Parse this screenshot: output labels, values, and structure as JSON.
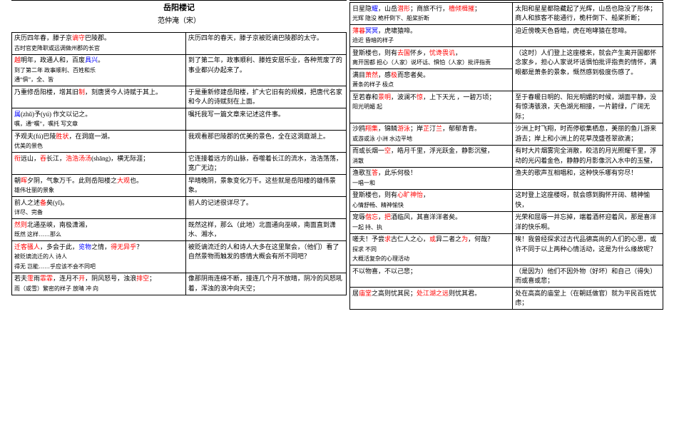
{
  "title": "岳阳楼记",
  "author": "范仲淹（宋）",
  "left_rows": [
    {
      "orig_lines": [
        {
          "segs": [
            {
              "t": "庆历四年春，滕子京"
            },
            {
              "t": "谪守",
              "r": true
            },
            {
              "t": "巴陵郡。"
            }
          ]
        },
        {
          "segs": [
            {
              "t": "古时官吏降职或远调做州郡的长官",
              "sub": true
            }
          ]
        }
      ],
      "tr": "庆历四年的春天，滕子京被贬谪巴陵郡的太守。",
      "rowspan": 1
    },
    {
      "orig_lines": [
        {
          "segs": [
            {
              "t": "越",
              "r": true
            },
            {
              "t": "明年"
            },
            {
              "t": "，政通人和，"
            },
            {
              "t": "百废"
            },
            {
              "t": "具兴",
              "bl": true
            },
            {
              "t": "。"
            }
          ]
        },
        {
          "segs": [
            {
              "t": "到了第二年  政事顺利、百姓和乐",
              "sub": true
            }
          ]
        },
        {
          "segs": [
            {
              "t": "通“俱”，全、皆",
              "sub": true
            }
          ]
        }
      ],
      "tr": "到了第二年，政事顺利、滕姓安居乐业，各种荒废了的事业都兴办起来了。"
    },
    {
      "orig_lines": [
        {
          "segs": [
            {
              "t": "乃重修岳阳楼，增其旧"
            },
            {
              "t": "制",
              "r": true
            },
            {
              "t": "，刻唐贤今人诗赋于其上。"
            }
          ]
        }
      ],
      "tr": "于是重新修建岳阳楼，扩大它旧有的规模，把唐代名家和今人的诗赋刻在上面。"
    },
    {
      "orig_lines": [
        {
          "segs": [
            {
              "t": "属",
              "bl": true
            },
            {
              "t": "(zhǔ)予(yú) 作文以记之。"
            }
          ]
        },
        {
          "segs": [
            {
              "t": "嘱，通“嘱”，嘱托    写文章",
              "sub": true
            }
          ]
        }
      ],
      "tr": "嘱托我写一篇文章来记述这件事。"
    },
    {
      "orig_lines": [
        {
          "segs": [
            {
              "t": "予观夫(fú)巴陵"
            },
            {
              "t": "胜状",
              "r": true
            },
            {
              "t": "，在洞庭一湖。"
            }
          ]
        },
        {
          "segs": [
            {
              "t": "优美的景色",
              "sub": true
            }
          ]
        }
      ],
      "tr": "我观看那巴陵郡的优美的景色，全在这洞庭湖上。"
    },
    {
      "orig_lines": [
        {
          "segs": [
            {
              "t": "衔",
              "r": true
            },
            {
              "t": "远山，"
            },
            {
              "t": "吞",
              "r": true
            },
            {
              "t": "长江，"
            },
            {
              "t": "浩浩汤汤",
              "r": true
            },
            {
              "t": "(shāng)，横无际涯；"
            }
          ]
        }
      ],
      "tr": "它连接着远方的山脉，吞噬着长江的流水，浩浩荡荡，宽广无边；"
    },
    {
      "orig_lines": [
        {
          "segs": [
            {
              "t": "朝"
            },
            {
              "t": "晖",
              "r": true
            },
            {
              "t": "夕阴，气象万千。此则岳阳楼之"
            },
            {
              "t": "大观",
              "r": true
            },
            {
              "t": "也。"
            }
          ]
        },
        {
          "segs": [
            {
              "t": "雄伟壮丽的景象",
              "sub": true
            }
          ]
        }
      ],
      "tr": "早晴晚阴，景象变化万千。这些就是岳阳楼的雄伟景象。"
    },
    {
      "orig_lines": [
        {
          "segs": [
            {
              "t": "前人之述"
            },
            {
              "t": "备",
              "r": true
            },
            {
              "t": "矣(yǐ)。"
            }
          ]
        },
        {
          "segs": [
            {
              "t": "详尽、完备",
              "sub": true
            }
          ]
        }
      ],
      "tr": "前人的记述很详尽了。"
    },
    {
      "orig_lines": [
        {
          "segs": [
            {
              "t": "然则",
              "r": true
            },
            {
              "t": "北通巫峡，南极潇湘，"
            }
          ]
        },
        {
          "segs": [
            {
              "t": "既然    这样……那么",
              "sub": true
            }
          ]
        }
      ],
      "tr": "既然这样，那么（此地）北面通向巫峡，南面直到潇水、湘水，"
    },
    {
      "orig_lines": [
        {
          "segs": [
            {
              "t": "迁客",
              "r": true
            },
            {
              "t": "骚人",
              "r": true
            },
            {
              "t": "，多会于此，"
            },
            {
              "t": "览物",
              "bl": true
            },
            {
              "t": "之情，"
            },
            {
              "t": "得无异乎",
              "r": true
            },
            {
              "t": "？"
            }
          ]
        },
        {
          "segs": [
            {
              "t": "被贬谪流迁的人  诗人",
              "sub": true
            }
          ]
        },
        {
          "segs": [
            {
              "t": "得无    岂能……乎应该不会不同吧",
              "sub": true
            }
          ]
        }
      ],
      "tr": "被贬谪流迁的人和诗人大多在这里聚会，（他们）看了自然景物而触发的感情大概会有所不同吧？"
    },
    {
      "orig_lines": [
        {
          "segs": [
            {
              "t": "若夫"
            },
            {
              "t": "霪",
              "r": true
            },
            {
              "t": "雨"
            },
            {
              "t": "霏霏",
              "r": true
            },
            {
              "t": "，连月不"
            },
            {
              "t": "开",
              "r": true
            },
            {
              "t": "，阴风怒号，浊浪"
            },
            {
              "t": "排空",
              "r": true
            },
            {
              "t": "；"
            }
          ]
        },
        {
          "segs": [
            {
              "t": "雨（或雪）繁密的样子    放晴        冲 向",
              "sub": true
            }
          ]
        }
      ],
      "tr": "像那阴雨连绵不断，接连几个月不放晴，阴冷的风怒吼着，浑浊的浪冲向天空；"
    }
  ],
  "right_rows": [
    {
      "orig_lines": [
        {
          "segs": [
            {
              "t": "日星隐"
            },
            {
              "t": "耀",
              "bl": true
            },
            {
              "t": "，山岳"
            },
            {
              "t": "潜形",
              "r": true
            },
            {
              "t": "；商旅不行，"
            },
            {
              "t": "樯倾楫摧",
              "r": true
            },
            {
              "t": "；"
            }
          ]
        },
        {
          "segs": [
            {
              "t": "光辉      隐没              桅杆倒下、船桨折断",
              "sub": true
            }
          ]
        }
      ],
      "tr": "太阳和星星都隐藏起了光辉，山岳也隐没了形体；商人和旅客不能通行，桅杆倒下、船桨折断；"
    },
    {
      "orig_lines": [
        {
          "segs": [
            {
              "t": "薄暮",
              "r": true
            },
            {
              "t": "冥冥",
              "bl": true
            },
            {
              "t": "，虎啸猿啼。"
            }
          ]
        },
        {
          "segs": [
            {
              "t": "迫近  昏暗的样子",
              "sub": true
            }
          ]
        }
      ],
      "tr": "迫近傍晚天色昏暗，虎在咆哮猿在悲啼。"
    },
    {
      "orig_lines": [
        {
          "segs": [
            {
              "t": "登斯楼也，则有"
            },
            {
              "t": "去国",
              "r": true
            },
            {
              "t": "怀乡，"
            },
            {
              "t": "忧谗畏讥",
              "r": true
            },
            {
              "t": "，"
            }
          ]
        },
        {
          "segs": [
            {
              "t": "离开国都        担心（人家）说坏话、惧怕（人家）批评指责",
              "sub": true
            }
          ]
        }
      ],
      "tr": "（这时）人们登上这座楼来，就会产生离开国都怀念家乡，担心人家说坏话惧怕批评指责的情怀，满眼都是萧条的景象，慨然感到极度伤感了。",
      "rowspan": 2
    },
    {
      "orig_lines": [
        {
          "segs": [
            {
              "t": "满目"
            },
            {
              "t": "萧然",
              "r": true
            },
            {
              "t": "，感"
            },
            {
              "t": "极",
              "r": true
            },
            {
              "t": "而悲者矣。"
            }
          ]
        },
        {
          "segs": [
            {
              "t": "萧条的样子  极点",
              "sub": true
            }
          ]
        }
      ],
      "tr": ""
    },
    {
      "orig_lines": [
        {
          "segs": [
            {
              "t": "至若春和"
            },
            {
              "t": "景明",
              "r": true
            },
            {
              "t": "，波澜不"
            },
            {
              "t": "惊",
              "r": true
            },
            {
              "t": "，上下天光 ，一碧万顷；"
            }
          ]
        },
        {
          "segs": [
            {
              "t": "阳光明媚        起",
              "sub": true
            }
          ]
        }
      ],
      "tr": "至于春暖日明的、阳光明媚的时候，湖面平静，没有惊涛骇浪，天色湖光相接，一片碧绿，广阔无际；"
    },
    {
      "orig_lines": [
        {
          "segs": [
            {
              "t": "沙鸥"
            },
            {
              "t": "翔集",
              "r": true
            },
            {
              "t": "，锦鳞"
            },
            {
              "t": "游泳",
              "r": true
            },
            {
              "t": "；岸"
            },
            {
              "t": "芷",
              "r": true
            },
            {
              "t": "汀"
            },
            {
              "t": "兰",
              "r": true
            },
            {
              "t": "，郁郁青青。"
            }
          ]
        },
        {
          "segs": [
            {
              "t": "或游或泳  小洲  水边平地",
              "sub": true
            }
          ]
        }
      ],
      "tr": "沙洲上时飞翔，时而停歇集栖息，美丽的鱼儿游来游去；岸上和小洲上的花草茂盛苍翠欲滴；"
    },
    {
      "orig_lines": [
        {
          "segs": [
            {
              "t": "而或长烟一"
            },
            {
              "t": "空",
              "r": true
            },
            {
              "t": "，皓月千里，浮光跃金，静影沉璧，"
            }
          ]
        },
        {
          "segs": [
            {
              "t": "消散",
              "sub": true
            }
          ]
        }
      ],
      "tr": "有时大片烟雾完全消散，皎洁的月光照耀千里，浮动的光闪着金色，静静的月影像沉入水中的玉璧，"
    },
    {
      "orig_lines": [
        {
          "segs": [
            {
              "t": "渔歌互"
            },
            {
              "t": "答",
              "r": true
            },
            {
              "t": "，此乐何极！"
            }
          ]
        },
        {
          "segs": [
            {
              "t": "一唱一和",
              "sub": true
            }
          ]
        }
      ],
      "tr": "渔夫的歌声互相唱和，这种快乐哪有穷尽！"
    },
    {
      "orig_lines": [
        {
          "segs": [
            {
              "t": "登斯楼也，则有"
            },
            {
              "t": "心旷神怡",
              "r": true
            },
            {
              "t": "，"
            }
          ]
        },
        {
          "segs": [
            {
              "t": "心情舒畅、精神愉快",
              "sub": true
            }
          ]
        }
      ],
      "tr": "这时登上这座楼呀，就会感到胸怀开阔、精神愉快，"
    },
    {
      "orig_lines": [
        {
          "segs": [
            {
              "t": "宠辱"
            },
            {
              "t": "偕忘",
              "r": true
            },
            {
              "t": "，"
            },
            {
              "t": "把",
              "r": true
            },
            {
              "t": "酒临风，其喜洋洋者矣。"
            }
          ]
        },
        {
          "segs": [
            {
              "t": "一起    持、执",
              "sub": true
            }
          ]
        }
      ],
      "tr": "光荣和屈辱一并忘掉，端着酒杯迎着风，那是喜洋洋的快乐啊。"
    },
    {
      "orig_lines": [
        {
          "segs": [
            {
              "t": "嗟夫！予尝"
            },
            {
              "t": "求",
              "r": true
            },
            {
              "t": "古仁人之心，"
            },
            {
              "t": "或",
              "r": true
            },
            {
              "t": "异二者之"
            },
            {
              "t": "为",
              "r": true
            },
            {
              "t": "，何哉？"
            }
          ]
        },
        {
          "segs": [
            {
              "t": "探求              不同",
              "sub": true
            }
          ]
        },
        {
          "segs": [
            {
              "t": "大概活复杂的心理活动",
              "sub": true
            }
          ]
        }
      ],
      "tr": "唉！我曾经探求过古代品德高尚的人们的心思，或许不同于以上两种心情活动，这是为什么缘故呢？"
    },
    {
      "orig_lines": [
        {
          "segs": [
            {
              "t": "不以物喜，不以己悲；"
            }
          ]
        }
      ],
      "tr": "（是因为）他们不因外物（好坏）和自己（得失）而或喜或悲；"
    },
    {
      "orig_lines": [
        {
          "segs": [
            {
              "t": "居"
            },
            {
              "t": "庙堂",
              "r": true
            },
            {
              "t": "之高则忧其民；"
            },
            {
              "t": "处江湖之远",
              "r": true
            },
            {
              "t": "则忧其君。"
            }
          ]
        }
      ],
      "tr": "处在高高的庙堂上（在朝廷做官）就为平民百姓忧虑；"
    }
  ]
}
